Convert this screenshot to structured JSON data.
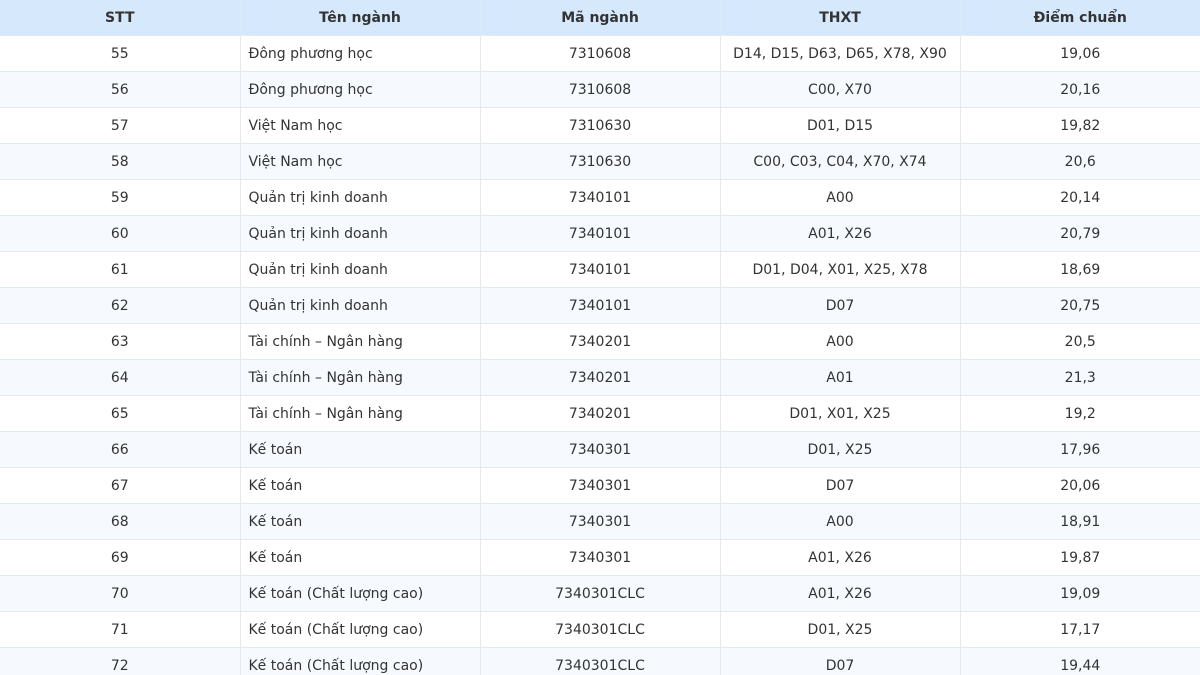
{
  "table": {
    "headers": [
      "STT",
      "Tên ngành",
      "Mã ngành",
      "THXT",
      "Điểm chuẩn"
    ],
    "rows": [
      [
        "55",
        "Đông phương học",
        "7310608",
        "D14, D15, D63, D65, X78, X90",
        "19,06"
      ],
      [
        "56",
        "Đông phương học",
        "7310608",
        "C00, X70",
        "20,16"
      ],
      [
        "57",
        "Việt Nam học",
        "7310630",
        "D01, D15",
        "19,82"
      ],
      [
        "58",
        "Việt Nam học",
        "7310630",
        "C00, C03, C04, X70, X74",
        "20,6"
      ],
      [
        "59",
        "Quản trị kinh doanh",
        "7340101",
        "A00",
        "20,14"
      ],
      [
        "60",
        "Quản trị kinh doanh",
        "7340101",
        "A01, X26",
        "20,79"
      ],
      [
        "61",
        "Quản trị kinh doanh",
        "7340101",
        "D01, D04, X01, X25, X78",
        "18,69"
      ],
      [
        "62",
        "Quản trị kinh doanh",
        "7340101",
        "D07",
        "20,75"
      ],
      [
        "63",
        "Tài chính – Ngân hàng",
        "7340201",
        "A00",
        "20,5"
      ],
      [
        "64",
        "Tài chính – Ngân hàng",
        "7340201",
        "A01",
        "21,3"
      ],
      [
        "65",
        "Tài chính – Ngân hàng",
        "7340201",
        "D01, X01, X25",
        "19,2"
      ],
      [
        "66",
        "Kế toán",
        "7340301",
        "D01, X25",
        "17,96"
      ],
      [
        "67",
        "Kế toán",
        "7340301",
        "D07",
        "20,06"
      ],
      [
        "68",
        "Kế toán",
        "7340301",
        "A00",
        "18,91"
      ],
      [
        "69",
        "Kế toán",
        "7340301",
        "A01, X26",
        "19,87"
      ],
      [
        "70",
        "Kế toán (Chất lượng cao)",
        "7340301CLC",
        "A01, X26",
        "19,09"
      ],
      [
        "71",
        "Kế toán (Chất lượng cao)",
        "7340301CLC",
        "D01, X25",
        "17,17"
      ],
      [
        "72",
        "Kế toán (Chất lượng cao)",
        "7340301CLC",
        "D07",
        "19,44"
      ]
    ]
  }
}
